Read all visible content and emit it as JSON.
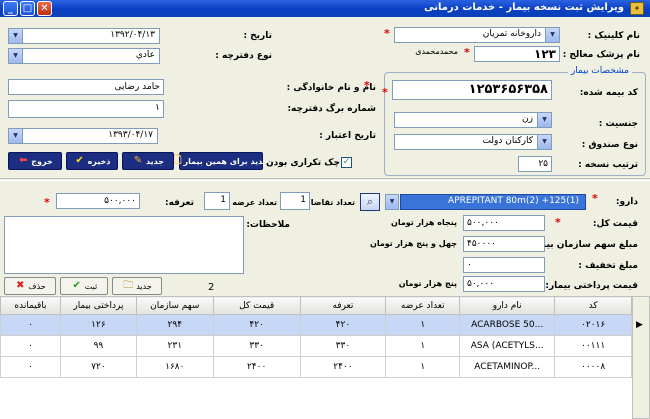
{
  "window": {
    "title": "ویرایش ثبت نسخه بیمار  -  خدمات درمانی",
    "icon_glyph": "✦",
    "minimize": "_",
    "maximize": "□",
    "close": "✕"
  },
  "header_form": {
    "clinic_label": "نام کلینیک :",
    "clinic_value": "داروخانه تمریان",
    "date_label": "تاریخ :",
    "date_value": "۱۳۹۲/۰۴/۱۳",
    "doctor_label": "نام پزشک معالج :",
    "doctor_code": "۱۲۳",
    "doctor_name": "محمدمحمدی",
    "book_type_label": "نوع دفترچه :",
    "book_type_value": "عادي"
  },
  "patient": {
    "group_title": "مشخصات بیمار",
    "insurance_label": "کد بیمه شده:",
    "insurance_value": "۱۲۵۳۶۵۶۳۵۸",
    "name_label": "نام و نام خانوادگی :",
    "name_value": "حامد رضایی",
    "page_label": "شماره برگ دفترچه:",
    "page_value": "۱",
    "gender_label": "جنسیت :",
    "gender_value": "زن",
    "validity_label": "تاریخ اعتبار :",
    "validity_value": "۱۳۹۳/۰۴/۱۷",
    "fund_label": "نوع صندوق :",
    "fund_value": "کارکنان دولت",
    "order_label": "ترتیب نسخه :",
    "order_value": "۲۵",
    "duplicate_label": "چک تکراری بودن",
    "duplicate_checked": "✓"
  },
  "actions": {
    "new_for_patient": "جدید برای همین بیمار",
    "new": "جدید",
    "save": "ذخیره",
    "exit": "خروج"
  },
  "drug": {
    "drug_label": "دارو:",
    "drug_value": "APREPITANT 80m(2) +125(1)",
    "request_label": "تعداد تقاضا :",
    "request_value": "1",
    "offered_label": "تعداد عرضه :",
    "offered_value": "1",
    "tariff_label": "تعرفه:",
    "tariff_value": "۵۰۰,۰۰۰",
    "notes_label": "ملاحظات:",
    "total_label": "قیمت کل:",
    "total_value": "۵۰۰,۰۰۰",
    "total_words": "پنجاه هزار تومان",
    "org_share_label": "مبلغ سهم سازمان بیمه:",
    "org_share_value": "۴۵۰۰۰۰",
    "org_share_words": "چهل و پنج هزار تومان",
    "discount_label": "مبلغ تخفیف :",
    "discount_value": "۰",
    "patient_pay_label": "قیمت پرداختی بیمار:",
    "patient_pay_value": "۵۰,۰۰۰",
    "patient_pay_words": "پنج هزار تومان",
    "count": "2"
  },
  "row_actions": {
    "new": "جدید",
    "register": "ثبت",
    "delete": "حذف"
  },
  "grid": {
    "columns": [
      "کد",
      "نام دارو",
      "تعداد عرضه",
      "تعرفه",
      "قیمت کل",
      "سهم سازمان",
      "پرداختی بیمار",
      "باقیمانده"
    ],
    "rows": [
      [
        "۰۲۰۱۶",
        "ACARBOSE 50...",
        "۱",
        "۴۲۰",
        "۴۲۰",
        "۲۹۴",
        "۱۲۶",
        "۰"
      ],
      [
        "۰۰۱۱۱",
        "ASA (ACETYLS...",
        "۱",
        "۳۳۰",
        "۳۳۰",
        "۲۳۱",
        "۹۹",
        "۰"
      ],
      [
        "۰۰۰۰۸",
        "ACETAMINOP...",
        "۱",
        "۲۴۰۰",
        "۲۴۰۰",
        "۱۶۸۰",
        "۷۲۰",
        "۰"
      ]
    ],
    "selected_row": 0,
    "row_pointer": "▶"
  },
  "colors": {
    "title_bar": "#0a3fc4",
    "accent": "#0046d5",
    "button_dark": "#1c2e82",
    "selected_row": "#c6d8f6",
    "required": "#e00000"
  }
}
